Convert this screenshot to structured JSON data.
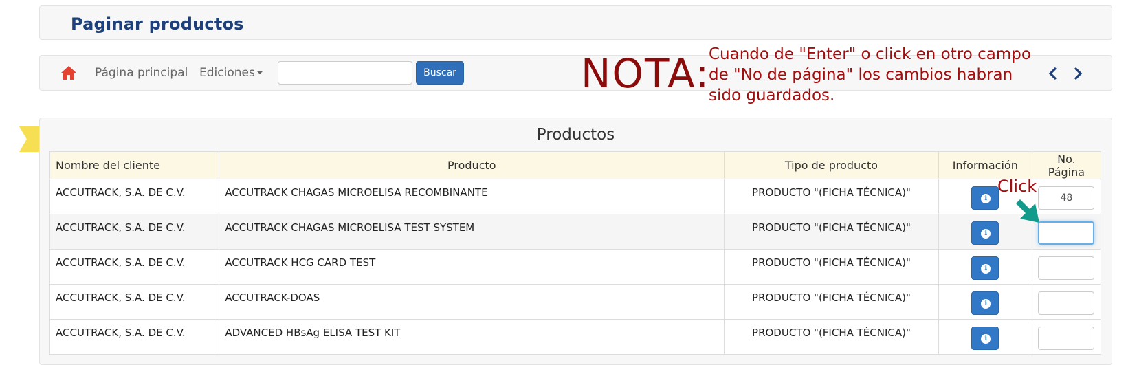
{
  "header": {
    "title": "Paginar productos"
  },
  "navbar": {
    "home_icon": "home-icon",
    "home_color": "#e2422f",
    "main_page_label": "Página principal",
    "editions_label": "Ediciones",
    "search_value": "",
    "search_button": "Buscar",
    "prev_icon": "chevron-left-icon",
    "next_icon": "chevron-right-icon",
    "arrow_color": "#1d3f7a"
  },
  "note": {
    "heading": "NOTA:",
    "text": "Cuando de \"Enter\" o click en otro campo de \"No de página\" los cambios habran sido guardados.",
    "color": "#a40d0d"
  },
  "annotation": {
    "click_label": "Click",
    "arrow_color": "#129a8a"
  },
  "products": {
    "heading": "Productos",
    "columns": [
      "Nombre del cliente",
      "Producto",
      "Tipo de producto",
      "Información",
      "No. Página"
    ],
    "rows": [
      {
        "client": "ACCUTRACK, S.A. DE C.V.",
        "product": "ACCUTRACK CHAGAS MICROELISA RECOMBINANTE",
        "type": "PRODUCTO \"(FICHA TÉCNICA)\"",
        "page": "48"
      },
      {
        "client": "ACCUTRACK, S.A. DE C.V.",
        "product": "ACCUTRACK CHAGAS MICROELISA TEST SYSTEM",
        "type": "PRODUCTO \"(FICHA TÉCNICA)\"",
        "page": ""
      },
      {
        "client": "ACCUTRACK, S.A. DE C.V.",
        "product": "ACCUTRACK HCG CARD TEST",
        "type": "PRODUCTO \"(FICHA TÉCNICA)\"",
        "page": ""
      },
      {
        "client": "ACCUTRACK, S.A. DE C.V.",
        "product": "ACCUTRACK-DOAS",
        "type": "PRODUCTO \"(FICHA TÉCNICA)\"",
        "page": ""
      },
      {
        "client": "ACCUTRACK, S.A. DE C.V.",
        "product": "ADVANCED HBsAg ELISA TEST KIT",
        "type": "PRODUCTO \"(FICHA TÉCNICA)\"",
        "page": ""
      }
    ],
    "info_icon": "info-icon",
    "active_row_index": 1
  }
}
